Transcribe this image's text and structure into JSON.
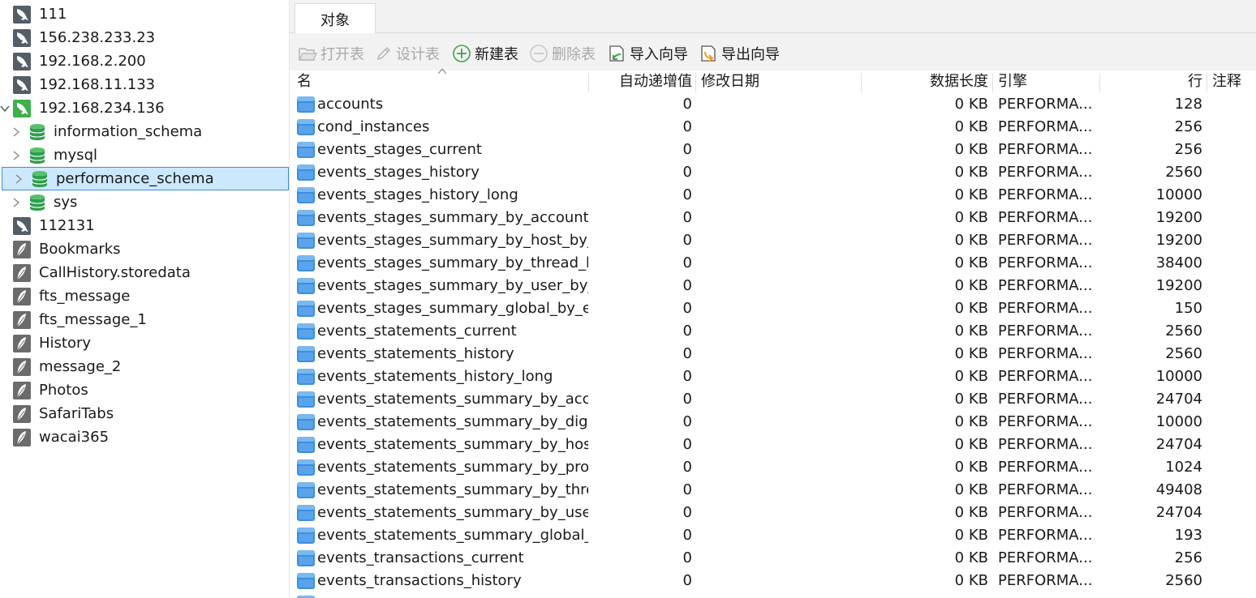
{
  "sidebar": {
    "items": [
      {
        "label": "111",
        "kind": "mysql-connection"
      },
      {
        "label": "156.238.233.23",
        "kind": "mysql-connection"
      },
      {
        "label": "192.168.2.200",
        "kind": "mysql-connection"
      },
      {
        "label": "192.168.11.133",
        "kind": "mysql-connection"
      },
      {
        "label": "192.168.234.136",
        "kind": "mysql-connection-open",
        "expanded": true
      },
      {
        "label": "information_schema",
        "kind": "database"
      },
      {
        "label": "mysql",
        "kind": "database"
      },
      {
        "label": "performance_schema",
        "kind": "database",
        "selected": true
      },
      {
        "label": "sys",
        "kind": "database"
      },
      {
        "label": "112131",
        "kind": "mysql-connection"
      },
      {
        "label": "Bookmarks",
        "kind": "sqlite-connection"
      },
      {
        "label": "CallHistory.storedata",
        "kind": "sqlite-connection"
      },
      {
        "label": "fts_message",
        "kind": "sqlite-connection"
      },
      {
        "label": "fts_message_1",
        "kind": "sqlite-connection"
      },
      {
        "label": "History",
        "kind": "sqlite-connection"
      },
      {
        "label": "message_2",
        "kind": "sqlite-connection"
      },
      {
        "label": "Photos",
        "kind": "sqlite-connection"
      },
      {
        "label": "SafariTabs",
        "kind": "sqlite-connection"
      },
      {
        "label": "wacai365",
        "kind": "sqlite-connection"
      }
    ]
  },
  "tabs": {
    "objects": "对象"
  },
  "toolbar": {
    "open_table": "打开表",
    "design_table": "设计表",
    "new_table": "新建表",
    "delete_table": "删除表",
    "import_wizard": "导入向导",
    "export_wizard": "导出向导"
  },
  "table": {
    "columns": {
      "name": "名",
      "auto_increment": "自动递增值",
      "modified_date": "修改日期",
      "data_length": "数据长度",
      "engine": "引擎",
      "rows": "行",
      "comment": "注释"
    },
    "rows": [
      {
        "name": "accounts",
        "auto_increment": "0",
        "modified_date": "",
        "data_length": "0 KB",
        "engine": "PERFORMA...",
        "rows": "128",
        "comment": ""
      },
      {
        "name": "cond_instances",
        "auto_increment": "0",
        "modified_date": "",
        "data_length": "0 KB",
        "engine": "PERFORMA...",
        "rows": "256",
        "comment": ""
      },
      {
        "name": "events_stages_current",
        "auto_increment": "0",
        "modified_date": "",
        "data_length": "0 KB",
        "engine": "PERFORMA...",
        "rows": "256",
        "comment": ""
      },
      {
        "name": "events_stages_history",
        "auto_increment": "0",
        "modified_date": "",
        "data_length": "0 KB",
        "engine": "PERFORMA...",
        "rows": "2560",
        "comment": ""
      },
      {
        "name": "events_stages_history_long",
        "auto_increment": "0",
        "modified_date": "",
        "data_length": "0 KB",
        "engine": "PERFORMA...",
        "rows": "10000",
        "comment": ""
      },
      {
        "name": "events_stages_summary_by_account_...",
        "auto_increment": "0",
        "modified_date": "",
        "data_length": "0 KB",
        "engine": "PERFORMA...",
        "rows": "19200",
        "comment": ""
      },
      {
        "name": "events_stages_summary_by_host_by_...",
        "auto_increment": "0",
        "modified_date": "",
        "data_length": "0 KB",
        "engine": "PERFORMA...",
        "rows": "19200",
        "comment": ""
      },
      {
        "name": "events_stages_summary_by_thread_b...",
        "auto_increment": "0",
        "modified_date": "",
        "data_length": "0 KB",
        "engine": "PERFORMA...",
        "rows": "38400",
        "comment": ""
      },
      {
        "name": "events_stages_summary_by_user_by_...",
        "auto_increment": "0",
        "modified_date": "",
        "data_length": "0 KB",
        "engine": "PERFORMA...",
        "rows": "19200",
        "comment": ""
      },
      {
        "name": "events_stages_summary_global_by_e...",
        "auto_increment": "0",
        "modified_date": "",
        "data_length": "0 KB",
        "engine": "PERFORMA...",
        "rows": "150",
        "comment": ""
      },
      {
        "name": "events_statements_current",
        "auto_increment": "0",
        "modified_date": "",
        "data_length": "0 KB",
        "engine": "PERFORMA...",
        "rows": "2560",
        "comment": ""
      },
      {
        "name": "events_statements_history",
        "auto_increment": "0",
        "modified_date": "",
        "data_length": "0 KB",
        "engine": "PERFORMA...",
        "rows": "2560",
        "comment": ""
      },
      {
        "name": "events_statements_history_long",
        "auto_increment": "0",
        "modified_date": "",
        "data_length": "0 KB",
        "engine": "PERFORMA...",
        "rows": "10000",
        "comment": ""
      },
      {
        "name": "events_statements_summary_by_acc...",
        "auto_increment": "0",
        "modified_date": "",
        "data_length": "0 KB",
        "engine": "PERFORMA...",
        "rows": "24704",
        "comment": ""
      },
      {
        "name": "events_statements_summary_by_dig...",
        "auto_increment": "0",
        "modified_date": "",
        "data_length": "0 KB",
        "engine": "PERFORMA...",
        "rows": "10000",
        "comment": ""
      },
      {
        "name": "events_statements_summary_by_host...",
        "auto_increment": "0",
        "modified_date": "",
        "data_length": "0 KB",
        "engine": "PERFORMA...",
        "rows": "24704",
        "comment": ""
      },
      {
        "name": "events_statements_summary_by_pro...",
        "auto_increment": "0",
        "modified_date": "",
        "data_length": "0 KB",
        "engine": "PERFORMA...",
        "rows": "1024",
        "comment": ""
      },
      {
        "name": "events_statements_summary_by_thre...",
        "auto_increment": "0",
        "modified_date": "",
        "data_length": "0 KB",
        "engine": "PERFORMA...",
        "rows": "49408",
        "comment": ""
      },
      {
        "name": "events_statements_summary_by_user...",
        "auto_increment": "0",
        "modified_date": "",
        "data_length": "0 KB",
        "engine": "PERFORMA...",
        "rows": "24704",
        "comment": ""
      },
      {
        "name": "events_statements_summary_global_...",
        "auto_increment": "0",
        "modified_date": "",
        "data_length": "0 KB",
        "engine": "PERFORMA...",
        "rows": "193",
        "comment": ""
      },
      {
        "name": "events_transactions_current",
        "auto_increment": "0",
        "modified_date": "",
        "data_length": "0 KB",
        "engine": "PERFORMA...",
        "rows": "256",
        "comment": ""
      },
      {
        "name": "events_transactions_history",
        "auto_increment": "0",
        "modified_date": "",
        "data_length": "0 KB",
        "engine": "PERFORMA...",
        "rows": "2560",
        "comment": ""
      }
    ]
  },
  "colors": {
    "selection_bg": "#cce8ff",
    "selection_border": "#3d8fd6",
    "mysql_active": "#3cb04b",
    "database_green": "#2e9e4f",
    "table_blue": "#3b8fe0",
    "toolbar_bg": "#f2f2f2",
    "new_green": "#3aa64a",
    "import_orange": "#f39a1e"
  }
}
